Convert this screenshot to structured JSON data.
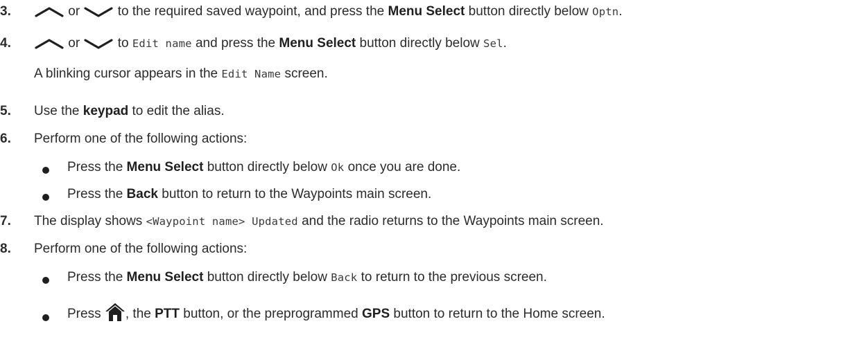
{
  "steps": [
    {
      "num": "3.",
      "parts": {
        "or": "or",
        "t1": "to the required saved waypoint, and press the",
        "b1": "Menu Select",
        "t2": "button directly below",
        "m1": "Optn",
        "end": "."
      }
    },
    {
      "num": "4.",
      "parts": {
        "or": "or",
        "t1": "to",
        "m1": "Edit name",
        "t2": "and press the",
        "b1": "Menu Select",
        "t3": "button directly below",
        "m2": "Sel",
        "end": "."
      },
      "note": {
        "t1": "A blinking cursor appears in the",
        "m1": "Edit Name",
        "t2": "screen."
      }
    },
    {
      "num": "5.",
      "parts": {
        "t1": "Use the",
        "b1": "keypad",
        "t2": "to edit the alias."
      }
    },
    {
      "num": "6.",
      "parts": {
        "t1": "Perform one of the following actions:"
      },
      "bullets": [
        {
          "t1": "Press the",
          "b1": "Menu Select",
          "t2": "button directly below",
          "m1": "Ok",
          "t3": "once you are done."
        },
        {
          "t1": "Press the",
          "b1": "Back",
          "t2": "button to return to the Waypoints main screen."
        }
      ]
    },
    {
      "num": "7.",
      "parts": {
        "t1": "The display shows",
        "m1": "<Waypoint name> Updated",
        "t2": "and the radio returns to the Waypoints main screen."
      }
    },
    {
      "num": "8.",
      "parts": {
        "t1": "Perform one of the following actions:"
      },
      "bullets": [
        {
          "t1": "Press the",
          "b1": "Menu Select",
          "t2": "button directly below",
          "m1": "Back",
          "t3": "to return to the previous screen."
        },
        {
          "t1": "Press",
          "t2": ", the",
          "b1": "PTT",
          "t3": "button, or the preprogrammed",
          "b2": "GPS",
          "t4": "button to return to the Home screen."
        }
      ]
    }
  ],
  "icons": {
    "up": "chevron-up-icon",
    "down": "chevron-down-icon",
    "home": "home-icon"
  },
  "colors": {
    "text": "#2b2b2b",
    "bold": "#1f1f1f"
  }
}
